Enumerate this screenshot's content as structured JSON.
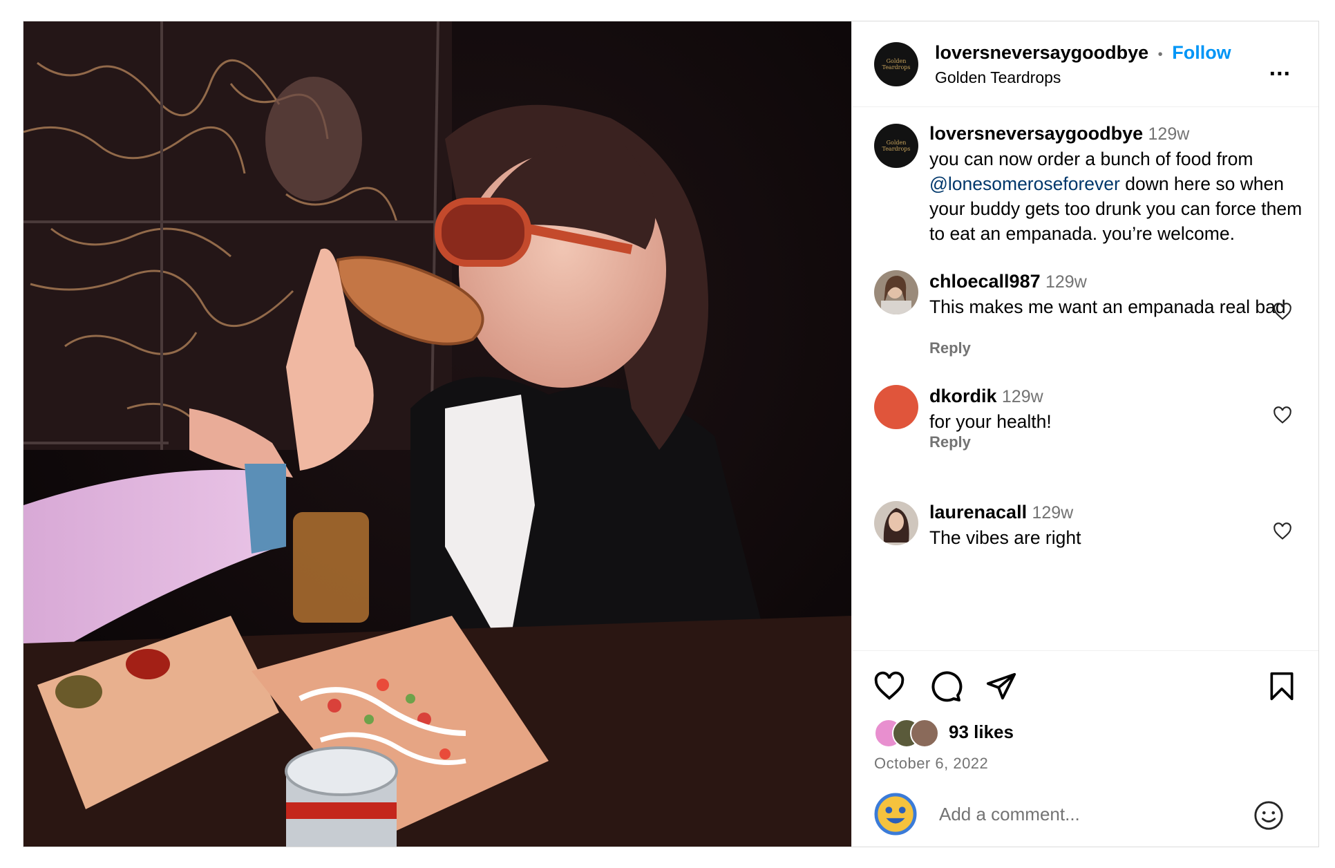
{
  "post": {
    "author": "loversneversaygoodbye",
    "follow_separator": "•",
    "follow_label": "Follow",
    "location": "Golden Teardrops",
    "avatar_text": "Golden Teardrops",
    "more_label": "..."
  },
  "caption": {
    "author": "loversneversaygoodbye",
    "time": "129w",
    "text_before": "you can now order a bunch of food from ",
    "mention": "@lonesomeroseforever",
    "text_after": " down here so when your buddy gets too drunk you can force them to eat an empanada. you’re welcome."
  },
  "comments": [
    {
      "user": "chloecall987",
      "time": "129w",
      "text": "This makes me want an empanada real bad",
      "reply_label": "Reply"
    },
    {
      "user": "dkordik",
      "time": "129w",
      "text": "for your health!",
      "reply_label": "Reply",
      "avatar_color": "#e0553b"
    },
    {
      "user": "laurenacall",
      "time": "129w",
      "text": "The vibes are right"
    }
  ],
  "actions": {
    "likes": "93 likes",
    "date": "October 6, 2022",
    "comment_placeholder": "Add a comment..."
  },
  "icons": [
    "like-icon",
    "comment-icon",
    "share-icon",
    "bookmark-icon",
    "more-icon",
    "emoji-icon"
  ],
  "colors": {
    "accent_blue": "#0095f6",
    "mention": "#00376b",
    "muted": "#737373",
    "border": "#dbdbdb"
  }
}
